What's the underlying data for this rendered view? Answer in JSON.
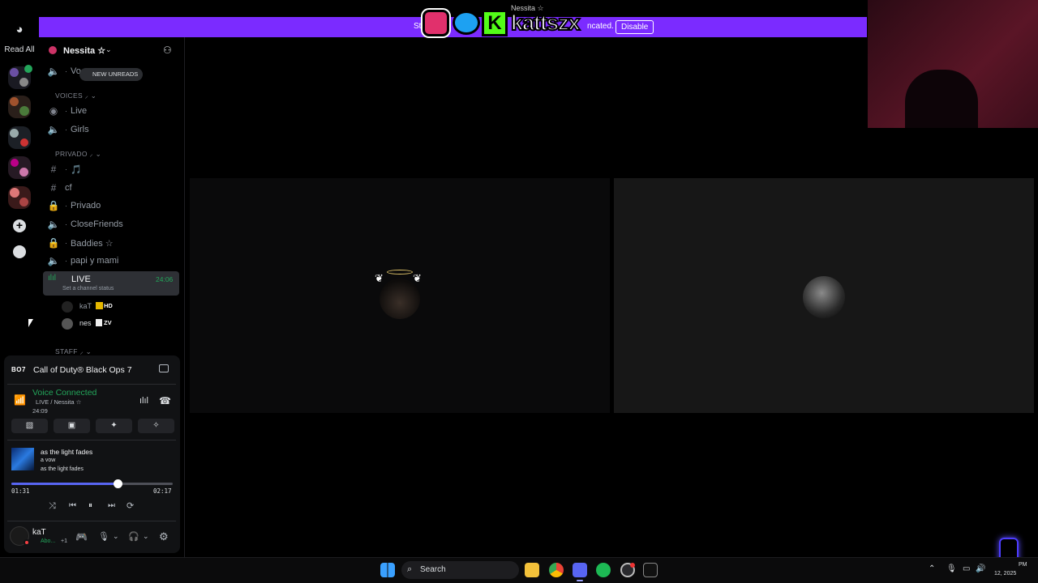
{
  "window_title": "Nessita ☆",
  "servers": {
    "read_all": "Read All"
  },
  "banner": {
    "text_left": "St",
    "text_right": "ncated.",
    "disable_label": "Disable",
    "overlay_handle": "kattszx",
    "overlay_k": "K",
    "colors": {
      "banner": "#7b2bff"
    }
  },
  "sidebar": {
    "server_name": "Nessita ☆",
    "new_unreads": "NEW UNREADS",
    "partial_channel": "Vo",
    "categories": {
      "voices": "VOICES ⸝ ⌄",
      "privado": "PRIVADO ⸝ ⌄",
      "staff": "STAFF ⸝ ⌄"
    },
    "channels": {
      "live_top": "Live",
      "girls": "Girls",
      "music": "🎵",
      "cf": "cf",
      "privado": "Privado",
      "closefriends": "CloseFriends",
      "baddies": "Baddies ☆",
      "papi": "papi y mami",
      "live": "LIVE",
      "live_timer": "24:06",
      "live_status": "Set a channel status"
    },
    "members": [
      {
        "name": "kaT",
        "badge": "HD"
      },
      {
        "name": "nes",
        "badge": "ZV"
      }
    ]
  },
  "activity": {
    "badge": "BO7",
    "game": "Call of Duty® Black Ops 7"
  },
  "voice": {
    "status": "Voice Connected",
    "channel": "LIVE / Nessita ☆",
    "timer": "24:09"
  },
  "music": {
    "title": "as the light fades",
    "artist": "a vow",
    "album": "as the light fades",
    "elapsed": "01:31",
    "duration": "02:17",
    "progress": 0.66
  },
  "user": {
    "name": "kaT",
    "status": "Abo...",
    "extra": "+1"
  },
  "taskbar": {
    "search_placeholder": "Search",
    "clock_time": "PM",
    "clock_date": "12, 2025",
    "clock_prefix": "12,"
  }
}
